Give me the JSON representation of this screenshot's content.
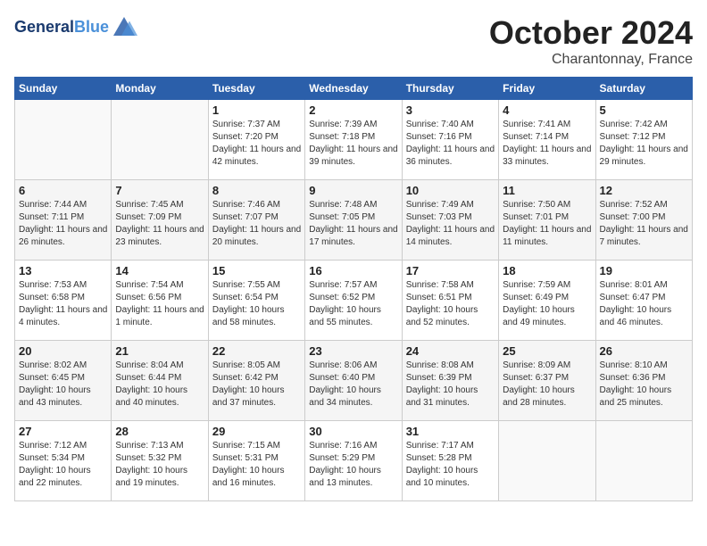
{
  "header": {
    "logo_line1": "General",
    "logo_line2": "Blue",
    "month": "October 2024",
    "location": "Charantonnay, France"
  },
  "days_of_week": [
    "Sunday",
    "Monday",
    "Tuesday",
    "Wednesday",
    "Thursday",
    "Friday",
    "Saturday"
  ],
  "weeks": [
    [
      {
        "day": "",
        "sunrise": "",
        "sunset": "",
        "daylight": ""
      },
      {
        "day": "",
        "sunrise": "",
        "sunset": "",
        "daylight": ""
      },
      {
        "day": "1",
        "sunrise": "Sunrise: 7:37 AM",
        "sunset": "Sunset: 7:20 PM",
        "daylight": "Daylight: 11 hours and 42 minutes."
      },
      {
        "day": "2",
        "sunrise": "Sunrise: 7:39 AM",
        "sunset": "Sunset: 7:18 PM",
        "daylight": "Daylight: 11 hours and 39 minutes."
      },
      {
        "day": "3",
        "sunrise": "Sunrise: 7:40 AM",
        "sunset": "Sunset: 7:16 PM",
        "daylight": "Daylight: 11 hours and 36 minutes."
      },
      {
        "day": "4",
        "sunrise": "Sunrise: 7:41 AM",
        "sunset": "Sunset: 7:14 PM",
        "daylight": "Daylight: 11 hours and 33 minutes."
      },
      {
        "day": "5",
        "sunrise": "Sunrise: 7:42 AM",
        "sunset": "Sunset: 7:12 PM",
        "daylight": "Daylight: 11 hours and 29 minutes."
      }
    ],
    [
      {
        "day": "6",
        "sunrise": "Sunrise: 7:44 AM",
        "sunset": "Sunset: 7:11 PM",
        "daylight": "Daylight: 11 hours and 26 minutes."
      },
      {
        "day": "7",
        "sunrise": "Sunrise: 7:45 AM",
        "sunset": "Sunset: 7:09 PM",
        "daylight": "Daylight: 11 hours and 23 minutes."
      },
      {
        "day": "8",
        "sunrise": "Sunrise: 7:46 AM",
        "sunset": "Sunset: 7:07 PM",
        "daylight": "Daylight: 11 hours and 20 minutes."
      },
      {
        "day": "9",
        "sunrise": "Sunrise: 7:48 AM",
        "sunset": "Sunset: 7:05 PM",
        "daylight": "Daylight: 11 hours and 17 minutes."
      },
      {
        "day": "10",
        "sunrise": "Sunrise: 7:49 AM",
        "sunset": "Sunset: 7:03 PM",
        "daylight": "Daylight: 11 hours and 14 minutes."
      },
      {
        "day": "11",
        "sunrise": "Sunrise: 7:50 AM",
        "sunset": "Sunset: 7:01 PM",
        "daylight": "Daylight: 11 hours and 11 minutes."
      },
      {
        "day": "12",
        "sunrise": "Sunrise: 7:52 AM",
        "sunset": "Sunset: 7:00 PM",
        "daylight": "Daylight: 11 hours and 7 minutes."
      }
    ],
    [
      {
        "day": "13",
        "sunrise": "Sunrise: 7:53 AM",
        "sunset": "Sunset: 6:58 PM",
        "daylight": "Daylight: 11 hours and 4 minutes."
      },
      {
        "day": "14",
        "sunrise": "Sunrise: 7:54 AM",
        "sunset": "Sunset: 6:56 PM",
        "daylight": "Daylight: 11 hours and 1 minute."
      },
      {
        "day": "15",
        "sunrise": "Sunrise: 7:55 AM",
        "sunset": "Sunset: 6:54 PM",
        "daylight": "Daylight: 10 hours and 58 minutes."
      },
      {
        "day": "16",
        "sunrise": "Sunrise: 7:57 AM",
        "sunset": "Sunset: 6:52 PM",
        "daylight": "Daylight: 10 hours and 55 minutes."
      },
      {
        "day": "17",
        "sunrise": "Sunrise: 7:58 AM",
        "sunset": "Sunset: 6:51 PM",
        "daylight": "Daylight: 10 hours and 52 minutes."
      },
      {
        "day": "18",
        "sunrise": "Sunrise: 7:59 AM",
        "sunset": "Sunset: 6:49 PM",
        "daylight": "Daylight: 10 hours and 49 minutes."
      },
      {
        "day": "19",
        "sunrise": "Sunrise: 8:01 AM",
        "sunset": "Sunset: 6:47 PM",
        "daylight": "Daylight: 10 hours and 46 minutes."
      }
    ],
    [
      {
        "day": "20",
        "sunrise": "Sunrise: 8:02 AM",
        "sunset": "Sunset: 6:45 PM",
        "daylight": "Daylight: 10 hours and 43 minutes."
      },
      {
        "day": "21",
        "sunrise": "Sunrise: 8:04 AM",
        "sunset": "Sunset: 6:44 PM",
        "daylight": "Daylight: 10 hours and 40 minutes."
      },
      {
        "day": "22",
        "sunrise": "Sunrise: 8:05 AM",
        "sunset": "Sunset: 6:42 PM",
        "daylight": "Daylight: 10 hours and 37 minutes."
      },
      {
        "day": "23",
        "sunrise": "Sunrise: 8:06 AM",
        "sunset": "Sunset: 6:40 PM",
        "daylight": "Daylight: 10 hours and 34 minutes."
      },
      {
        "day": "24",
        "sunrise": "Sunrise: 8:08 AM",
        "sunset": "Sunset: 6:39 PM",
        "daylight": "Daylight: 10 hours and 31 minutes."
      },
      {
        "day": "25",
        "sunrise": "Sunrise: 8:09 AM",
        "sunset": "Sunset: 6:37 PM",
        "daylight": "Daylight: 10 hours and 28 minutes."
      },
      {
        "day": "26",
        "sunrise": "Sunrise: 8:10 AM",
        "sunset": "Sunset: 6:36 PM",
        "daylight": "Daylight: 10 hours and 25 minutes."
      }
    ],
    [
      {
        "day": "27",
        "sunrise": "Sunrise: 7:12 AM",
        "sunset": "Sunset: 5:34 PM",
        "daylight": "Daylight: 10 hours and 22 minutes."
      },
      {
        "day": "28",
        "sunrise": "Sunrise: 7:13 AM",
        "sunset": "Sunset: 5:32 PM",
        "daylight": "Daylight: 10 hours and 19 minutes."
      },
      {
        "day": "29",
        "sunrise": "Sunrise: 7:15 AM",
        "sunset": "Sunset: 5:31 PM",
        "daylight": "Daylight: 10 hours and 16 minutes."
      },
      {
        "day": "30",
        "sunrise": "Sunrise: 7:16 AM",
        "sunset": "Sunset: 5:29 PM",
        "daylight": "Daylight: 10 hours and 13 minutes."
      },
      {
        "day": "31",
        "sunrise": "Sunrise: 7:17 AM",
        "sunset": "Sunset: 5:28 PM",
        "daylight": "Daylight: 10 hours and 10 minutes."
      },
      {
        "day": "",
        "sunrise": "",
        "sunset": "",
        "daylight": ""
      },
      {
        "day": "",
        "sunrise": "",
        "sunset": "",
        "daylight": ""
      }
    ]
  ]
}
